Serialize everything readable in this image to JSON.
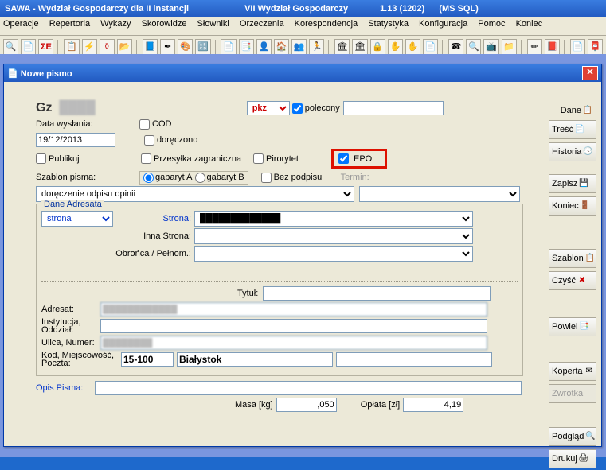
{
  "app_title": {
    "app": "SAWA  -  Wydział Gospodarczy dla II instancji",
    "dept": "VII  Wydział Gospodarczy",
    "ver": "1.13  (1202)",
    "db": "(MS SQL)"
  },
  "menu": [
    "Operacje",
    "Repertoria",
    "Wykazy",
    "Skorowidze",
    "Słowniki",
    "Orzeczenia",
    "Korespondencja",
    "Statystyka",
    "Konfiguracja",
    "Pomoc",
    "Koniec"
  ],
  "child_title": "Nowe pismo",
  "right_buttons": {
    "dane": "Dane",
    "tresc": "Treść",
    "historia": "Historia",
    "zapisz": "Zapisz",
    "koniec": "Koniec",
    "szablon": "Szablon",
    "czysc": "Czyść",
    "powiel": "Powiel",
    "koperta": "Koperta",
    "zwrotka": "Zwrotka",
    "podglad": "Podgląd",
    "drukuj": "Drukuj"
  },
  "form": {
    "gz": "Gz",
    "pkz": "pkz",
    "polecony": "polecony",
    "data_wyslania_lbl": "Data wysłania:",
    "data_wyslania_val": "19/12/2013",
    "cod": "COD",
    "doreczono": "doręczono",
    "publikuj": "Publikuj",
    "przesylka": "Przesyłka zagraniczna",
    "priorytet": "Pirorytet",
    "epo": "EPO",
    "szablon_lbl": "Szablon pisma:",
    "gabaryt_a": "gabaryt A",
    "gabaryt_b": "gabaryt B",
    "bez_podpisu": "Bez podpisu",
    "termin": "Termin:",
    "szablon_val": "doręczenie odpisu opinii",
    "dane_adresata": "Dane Adresata",
    "strona_sel": "strona",
    "strona_lbl": "Strona:",
    "inna_strona_lbl": "Inna Strona:",
    "obronca_lbl": "Obrońca / Pełnom.:",
    "tytul_lbl": "Tytuł:",
    "adresat_lbl": "Adresat:",
    "instytucja_lbl": "Instytucja,\nOddział:",
    "ulica_lbl": "Ulica, Numer:",
    "kod_lbl": "Kod, Miejscowość,\nPoczta:",
    "kod_val": "15-100",
    "miasto_val": "Białystok",
    "opis_lbl": "Opis Pisma:",
    "masa_lbl": "Masa [kg]",
    "masa_val": ",050",
    "oplata_lbl": "Opłata [zł]",
    "oplata_val": "4,19"
  }
}
